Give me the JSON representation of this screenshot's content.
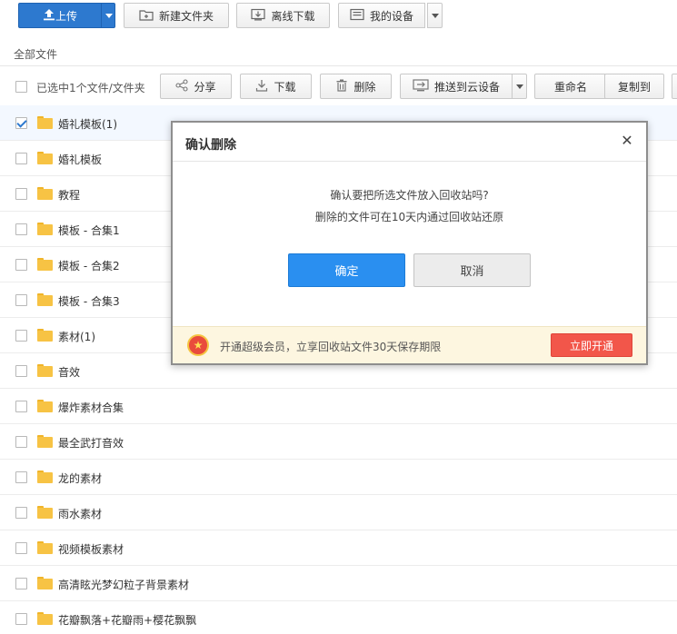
{
  "toolbar": {
    "upload_label": "上传",
    "new_folder_label": "新建文件夹",
    "offline_download_label": "离线下载",
    "my_devices_label": "我的设备"
  },
  "breadcrumb": "全部文件",
  "actions": {
    "selected_text": "已选中1个文件/文件夹",
    "share": "分享",
    "download": "下载",
    "delete": "删除",
    "push_cloud": "推送到云设备",
    "rename": "重命名",
    "copy_to": "复制到"
  },
  "files": [
    {
      "name": "婚礼模板(1)",
      "checked": true
    },
    {
      "name": "婚礼模板",
      "checked": false
    },
    {
      "name": "教程",
      "checked": false
    },
    {
      "name": "模板 - 合集1",
      "checked": false
    },
    {
      "name": "模板 - 合集2",
      "checked": false
    },
    {
      "name": "模板 - 合集3",
      "checked": false
    },
    {
      "name": "素材(1)",
      "checked": false
    },
    {
      "name": "音效",
      "checked": false
    },
    {
      "name": "爆炸素材合集",
      "checked": false
    },
    {
      "name": "最全武打音效",
      "checked": false
    },
    {
      "name": "龙的素材",
      "checked": false
    },
    {
      "name": "雨水素材",
      "checked": false
    },
    {
      "name": "视频模板素材",
      "checked": false
    },
    {
      "name": "高清眩光梦幻粒子背景素材",
      "checked": false
    },
    {
      "name": "花瓣飘落+花瓣雨+樱花飘飘",
      "checked": false
    }
  ],
  "dialog": {
    "title": "确认删除",
    "close_glyph": "✕",
    "message_line1": "确认要把所选文件放入回收站吗?",
    "message_line2": "删除的文件可在10天内通过回收站还原",
    "confirm_label": "确定",
    "cancel_label": "取消",
    "promo_text": "开通超级会员，立享回收站文件30天保存期限",
    "promo_button": "立即开通"
  },
  "colors": {
    "primary": "#2d79cf",
    "confirm": "#2a8ff0",
    "promo_button": "#f2564a",
    "promo_bg": "#fdf6e0"
  },
  "icons": {
    "upload": "upload-icon",
    "new_folder": "new-folder-icon",
    "offline_download": "offline-download-icon",
    "my_devices": "device-icon",
    "share": "share-icon",
    "download": "download-icon",
    "delete": "trash-icon",
    "push_cloud": "cloud-device-icon",
    "folder": "folder-icon",
    "close": "close-icon",
    "vip": "vip-crown-icon"
  }
}
